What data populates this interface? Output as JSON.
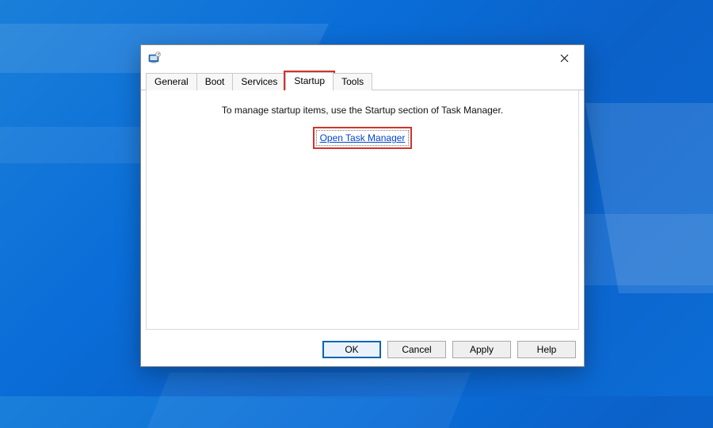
{
  "window": {
    "title": ""
  },
  "tabs": {
    "general": "General",
    "boot": "Boot",
    "services": "Services",
    "startup": "Startup",
    "tools": "Tools",
    "active": "startup"
  },
  "content": {
    "message": "To manage startup items, use the Startup section of Task Manager.",
    "link_label": "Open Task Manager"
  },
  "buttons": {
    "ok": "OK",
    "cancel": "Cancel",
    "apply": "Apply",
    "help": "Help"
  }
}
